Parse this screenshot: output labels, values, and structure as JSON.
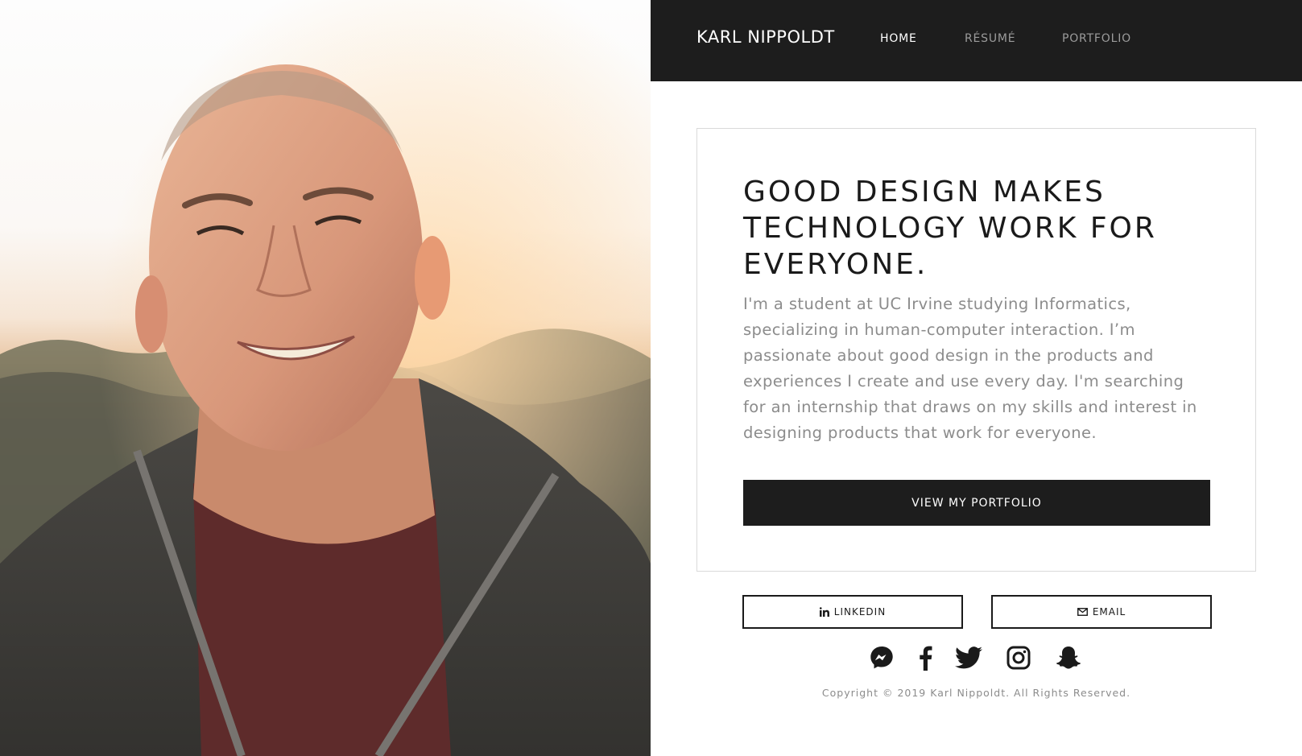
{
  "nav": {
    "brand": "KARL NIPPOLDT",
    "links": [
      {
        "label": "HOME",
        "active": true
      },
      {
        "label": "RÉSUMÉ",
        "active": false
      },
      {
        "label": "PORTFOLIO",
        "active": false
      }
    ]
  },
  "hero": {
    "headline": "GOOD DESIGN MAKES TECHNOLOGY WORK FOR EVERYONE.",
    "intro": "I'm a student at UC Irvine studying Informatics, specializing in human-computer interaction. I’m passionate about good design in the products and experiences I create and use every day. I'm searching for an internship that draws on my skills and interest in designing products that work for everyone.",
    "cta_label": "VIEW MY PORTFOLIO"
  },
  "contact": {
    "linkedin_label": "LINKEDIN",
    "email_label": "EMAIL"
  },
  "social_icons": [
    "messenger-icon",
    "facebook-icon",
    "twitter-icon",
    "instagram-icon",
    "snapchat-icon"
  ],
  "footer": {
    "copyright": "Copyright © 2019 Karl Nippoldt. All Rights Reserved."
  },
  "colors": {
    "nav_bg": "#1d1d1d",
    "accent_dark": "#1d1d1d",
    "body_text_muted": "#8c8c8c",
    "card_border": "#dadada"
  }
}
